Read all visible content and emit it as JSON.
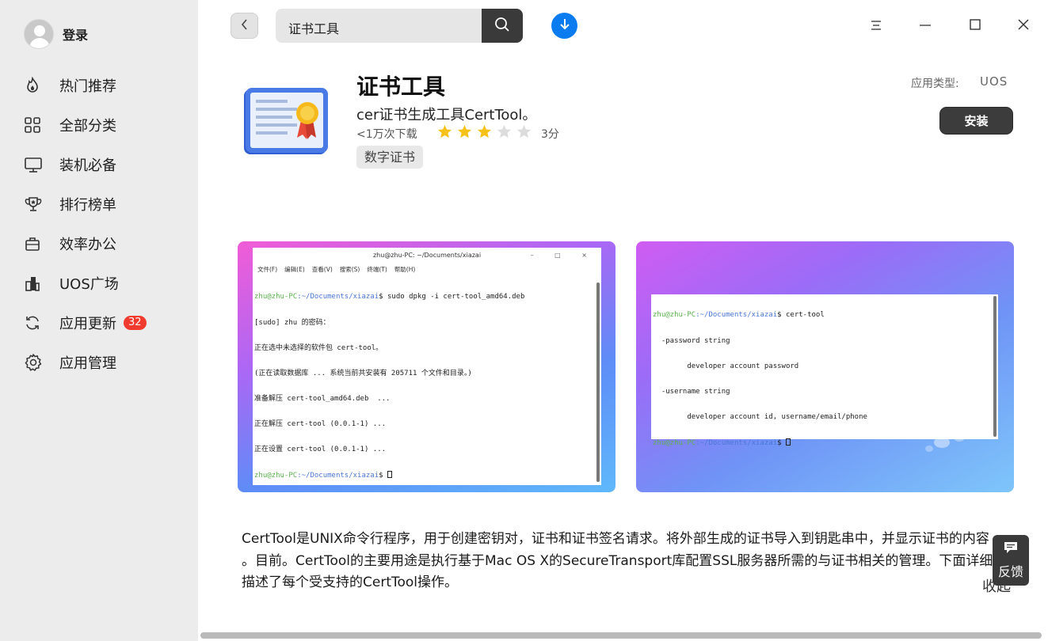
{
  "sidebar": {
    "user": {
      "name": "登录"
    },
    "items": [
      {
        "label": "热门推荐",
        "icon": "fire-icon"
      },
      {
        "label": "全部分类",
        "icon": "grid-icon"
      },
      {
        "label": "装机必备",
        "icon": "monitor-icon"
      },
      {
        "label": "排行榜单",
        "icon": "trophy-icon"
      },
      {
        "label": "效率办公",
        "icon": "briefcase-icon"
      },
      {
        "label": "UOS广场",
        "icon": "building-icon"
      },
      {
        "label": "应用更新",
        "icon": "refresh-icon",
        "badge": "32"
      },
      {
        "label": "应用管理",
        "icon": "gear-icon"
      }
    ]
  },
  "topbar": {
    "search_value": "证书工具"
  },
  "app": {
    "title": "证书工具",
    "subtitle": "cer证书生成工具CertTool。",
    "downloads": "<1万次下载",
    "rating": 3,
    "rating_max": 5,
    "score": "3分",
    "tag": "数字证书",
    "type_label": "应用类型:",
    "type_value": "UOS",
    "install_label": "安装"
  },
  "screenshots": [
    {
      "title": "zhu@zhu-PC: ~/Documents/xiazai",
      "menu": [
        "文件(F)",
        "编辑(E)",
        "查看(V)",
        "搜索(S)",
        "终端(T)",
        "帮助(H)"
      ],
      "lines": [
        {
          "prompt_user": "zhu@zhu-PC",
          "prompt_path": ":~/Documents/xiazai",
          "cmd": "$ sudo dpkg -i cert-tool_amd64.deb"
        },
        {
          "text": "[sudo] zhu 的密码："
        },
        {
          "text": "正在选中未选择的软件包 cert-tool。"
        },
        {
          "text": "(正在读取数据库 ... 系统当前共安装有 205711 个文件和目录。)"
        },
        {
          "text": "准备解压 cert-tool_amd64.deb  ..."
        },
        {
          "text": "正在解压 cert-tool (0.0.1-1) ..."
        },
        {
          "text": "正在设置 cert-tool (0.0.1-1) ..."
        },
        {
          "prompt_user": "zhu@zhu-PC",
          "prompt_path": ":~/Documents/xiazai",
          "cmd": "$ "
        }
      ]
    },
    {
      "lines": [
        {
          "prompt_user": "zhu@zhu-PC",
          "prompt_path": ":~/Documents/xiazai",
          "cmd": "$ cert-tool"
        },
        {
          "text": "  -password string"
        },
        {
          "text": "        developer account password"
        },
        {
          "text": "  -username string"
        },
        {
          "text": "        developer account id, username/email/phone"
        },
        {
          "prompt_user": "zhu@zhu-PC",
          "prompt_path": ":~/Documents/xiazai",
          "cmd": "$ "
        }
      ]
    }
  ],
  "description": {
    "line1": "CertTool是UNIX命令行程序，用于创建密钥对，证书和证书签名请求。将外部生成的证书导入到钥匙串中，并显示证书的内容",
    "line2": "。目前。CertTool的主要用途是执行基于Mac OS X的SecureTransport库配置SSL服务器所需的与证书相关的管理。下面详细",
    "line3": "描述了每个受支持的CertTool操作。",
    "collapse_label": "收起"
  },
  "feedback": {
    "label": "反馈"
  },
  "colors": {
    "accent": "#0a7cf0",
    "badge": "#f03b2e",
    "star": "#f6c21a",
    "dark_button": "#3c3c3c"
  }
}
